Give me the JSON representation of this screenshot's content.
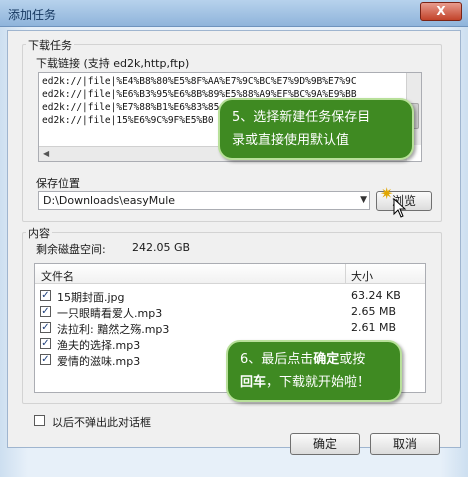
{
  "window": {
    "title": "添加任务",
    "close_glyph": "X"
  },
  "download_group": {
    "legend": "下载任务",
    "url_label": "下载链接 (支持 ed2k,http,ftp)",
    "urls": [
      "ed2k://|file|%E4%B8%80%E5%8F%AA%E7%9C%BC%E7%9D%9B%E7%9C",
      "ed2k://|file|%E6%B3%95%E6%8B%89%E5%88%A9%EF%BC%9A%E9%BB",
      "ed2k://|file|%E7%88%B1%E6%83%85",
      "ed2k://|file|15%E6%9C%9F%E5%B0"
    ],
    "save_label": "保存位置",
    "save_path": "D:\\Downloads\\easyMule",
    "browse_label": "浏览"
  },
  "content_group": {
    "legend": "内容",
    "free_space_label": "剩余磁盘空间:",
    "free_space_value": "242.05 GB",
    "columns": [
      "文件名",
      "大小"
    ],
    "files": [
      {
        "name": "15期封面.jpg",
        "size": "63.24 KB",
        "checked": true
      },
      {
        "name": "一只眼睛看爱人.mp3",
        "size": "2.65 MB",
        "checked": true
      },
      {
        "name": "法拉利: 黯然之殇.mp3",
        "size": "2.61 MB",
        "checked": true
      },
      {
        "name": "渔夫的选择.mp3",
        "size": "",
        "checked": true
      },
      {
        "name": "爱情的滋味.mp3",
        "size": "",
        "checked": true
      }
    ]
  },
  "footer": {
    "dont_show_label": "以后不弹出此对话框",
    "ok_label": "确定",
    "cancel_label": "取消"
  },
  "annotations": {
    "step5_line1": "5、选择新建任务保存目",
    "step5_line2": "录或直接使用默认值",
    "step6_line1_a": "6、最后点击",
    "step6_line1_bold": "确定",
    "step6_line1_b": "或按",
    "step6_line2_bold": "回车",
    "step6_line2_b": "，下载就开始啦！"
  },
  "colors": {
    "bubble_bg": "#3f8a22",
    "bubble_border": "#b8e09a",
    "titlebar": "#8fb4db"
  }
}
